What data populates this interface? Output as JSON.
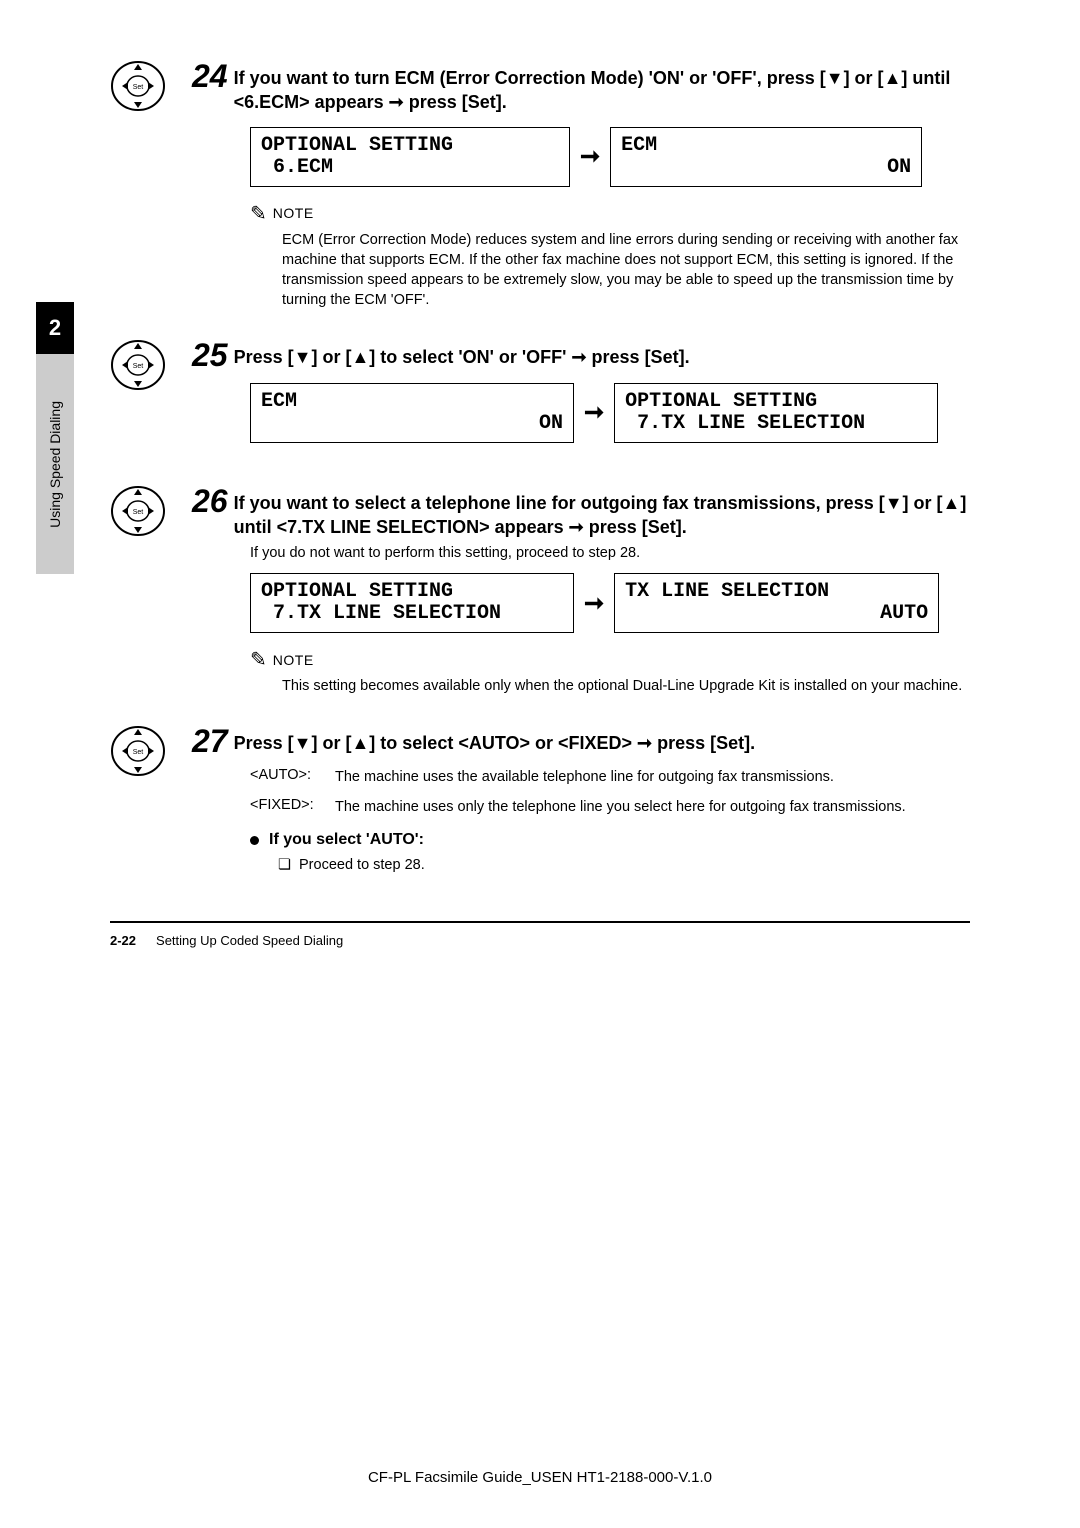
{
  "tab": {
    "num": "2",
    "label": "Using Speed Dialing"
  },
  "step24": {
    "num": "24",
    "text_a": "If you want to turn ECM (Error Correction Mode) 'ON' or 'OFF', press [",
    "text_b": "] or [",
    "text_c": "] until <6.ECM> appears ",
    "text_d": " press [Set].",
    "lcd1_l1": "OPTIONAL SETTING",
    "lcd1_l2": " 6.ECM",
    "lcd2_l1": "ECM",
    "lcd2_l2": "ON",
    "note_label": "NOTE",
    "note_body": "ECM (Error Correction Mode) reduces system and line errors during sending or receiving with another fax machine that supports ECM. If the other fax machine does not support ECM, this setting is ignored. If the transmission speed appears to be extremely slow, you may be able to speed up the transmission time by turning the ECM 'OFF'."
  },
  "step25": {
    "num": "25",
    "text_a": "Press [",
    "text_b": "] or [",
    "text_c": "] to select 'ON' or 'OFF' ",
    "text_d": " press [Set].",
    "lcd1_l1": "ECM",
    "lcd1_l2": "ON",
    "lcd2_l1": "OPTIONAL SETTING",
    "lcd2_l2": " 7.TX LINE SELECTION"
  },
  "step26": {
    "num": "26",
    "text_a": "If you want to select a telephone line for outgoing fax transmissions, press [",
    "text_b": "] or [",
    "text_c": "] until <7.TX LINE SELECTION> appears ",
    "text_d": " press [Set].",
    "body": "If you do not want to perform this setting, proceed to step 28.",
    "lcd1_l1": "OPTIONAL SETTING",
    "lcd1_l2": " 7.TX LINE SELECTION",
    "lcd2_l1": "TX LINE SELECTION",
    "lcd2_l2": "AUTO",
    "note_label": "NOTE",
    "note_body": "This setting becomes available only when the optional Dual-Line Upgrade Kit is installed on your machine."
  },
  "step27": {
    "num": "27",
    "text_a": "Press [",
    "text_b": "] or [",
    "text_c": "] to select <AUTO> or <FIXED> ",
    "text_d": " press [Set].",
    "opt1_label": "<AUTO>:",
    "opt1_desc": "The machine uses the available telephone line for outgoing fax transmissions.",
    "opt2_label": "<FIXED>:",
    "opt2_desc": "The machine uses only the telephone line you select here for outgoing fax transmissions.",
    "bullet": "If you select 'AUTO':",
    "sub_mark": "❏",
    "sub_text": "Proceed to step 28."
  },
  "footer": {
    "page": "2-22",
    "title": "Setting Up Coded Speed Dialing"
  },
  "bottom": "CF-PL Facsimile Guide_USEN HT1-2188-000-V.1.0",
  "glyphs": {
    "down": "▼",
    "up": "▲",
    "rarr": "➞"
  }
}
